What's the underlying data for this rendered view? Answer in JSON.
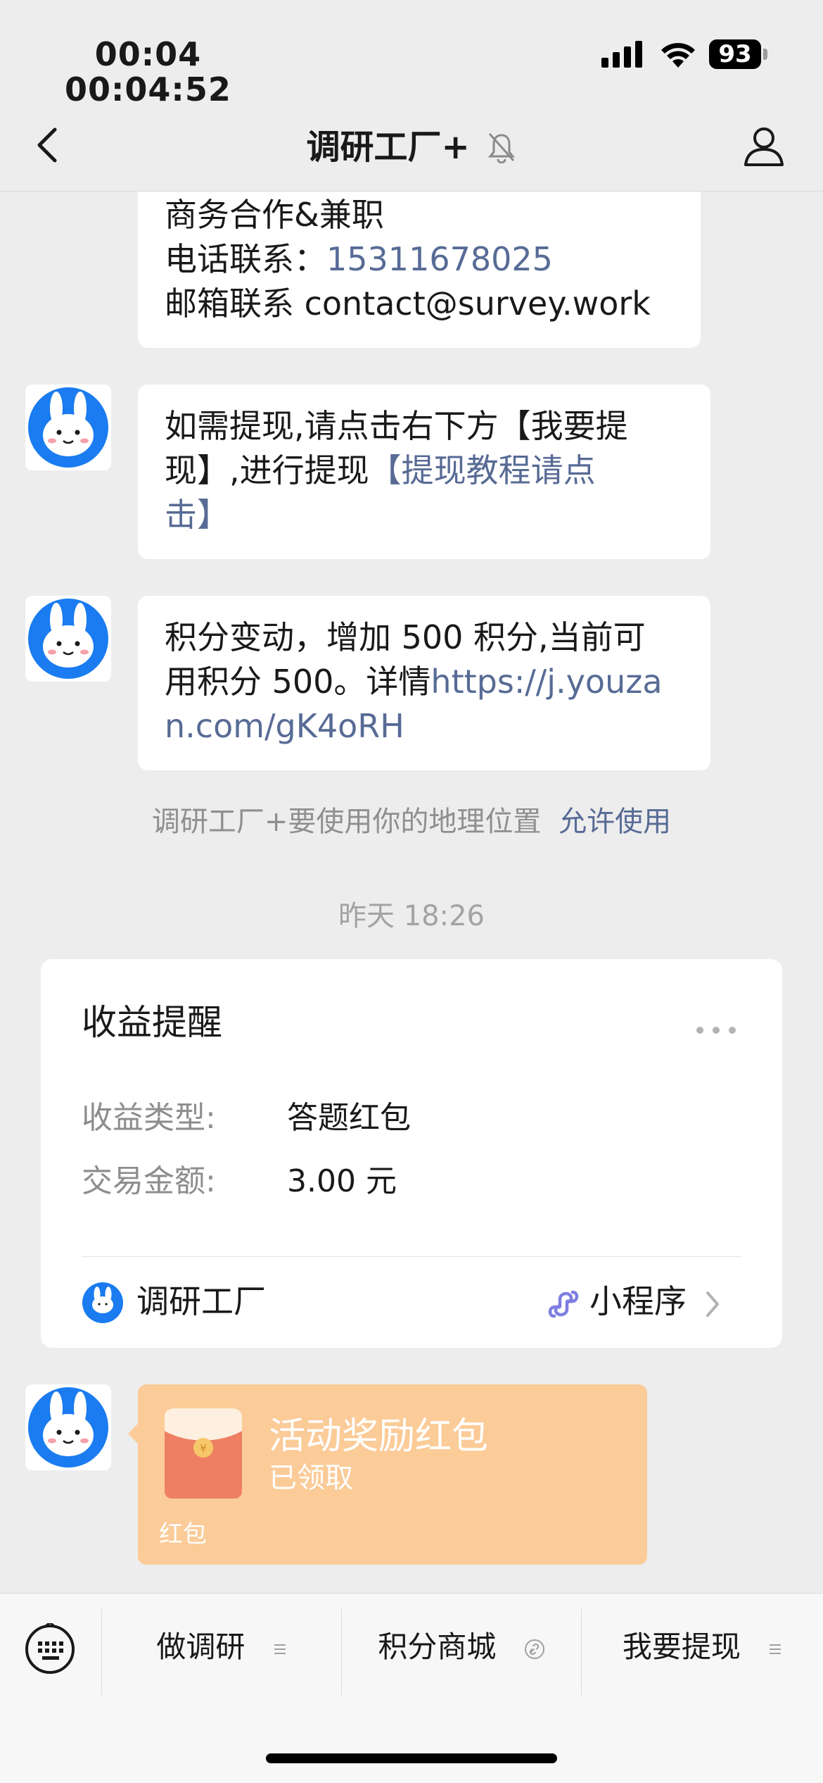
{
  "status_bar": {
    "time_line1": "00:04",
    "time_line2": "00:04:52",
    "battery": "93"
  },
  "nav": {
    "title": "调研工厂+",
    "back_icon": "chevron-left-icon",
    "mute_icon": "bell-off-icon",
    "profile_icon": "person-icon"
  },
  "messages": {
    "contact": {
      "line1": "商务合作&兼职",
      "line2_label": "电话联系：",
      "line2_phone": "15311678025",
      "line3": "邮箱联系 contact@survey.work"
    },
    "withdraw": {
      "line1": "如需提现,请点击右下方【我要提",
      "line2_text": "现】,进行提现",
      "line2_link": "【提现教程请点",
      "line3_link": "击】"
    },
    "points": {
      "line1": "积分变动，增加 500 积分,当前可",
      "line2_text": "用积分 500。详情",
      "line2_link": "https://j.youza",
      "line3_link": "n.com/gK4oRH"
    },
    "location_note": "调研工厂+要使用你的地理位置",
    "location_action": "允许使用",
    "timestamp": "昨天 18:26"
  },
  "earnings_card": {
    "title": "收益提醒",
    "rows": [
      {
        "label": "收益类型:",
        "value": "答题红包"
      },
      {
        "label": "交易金额:",
        "value": "3.00 元"
      }
    ],
    "mini_program_name": "调研工厂",
    "mini_program_tag": "小程序"
  },
  "red_packet": {
    "title": "活动奖励红包",
    "status": "已领取",
    "label": "红包",
    "color": "#fbcb98"
  },
  "bottom_menu": {
    "items": [
      {
        "label": "做调研",
        "icon": "menu-lines-icon"
      },
      {
        "label": "积分商城",
        "icon": "link-icon"
      },
      {
        "label": "我要提现",
        "icon": "menu-lines-icon"
      }
    ]
  },
  "colors": {
    "background": "#ededed",
    "link": "#576b95",
    "avatar_blue": "#1a7cf0"
  }
}
